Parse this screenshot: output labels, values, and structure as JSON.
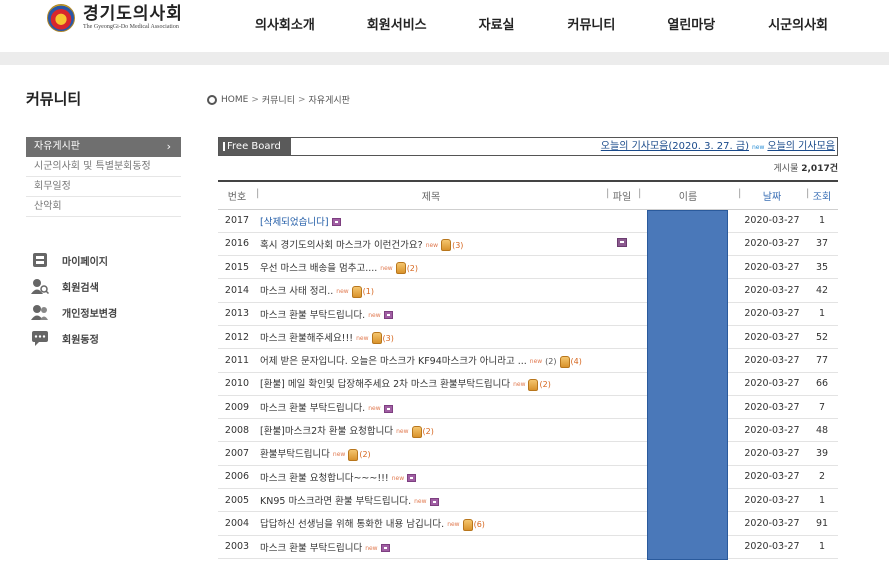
{
  "header": {
    "logo_kr": "경기도의사회",
    "logo_en": "The GyeongGi-Do Medical Association",
    "nav": [
      "의사회소개",
      "회원서비스",
      "자료실",
      "커뮤니티",
      "열린마당",
      "시군의사회"
    ]
  },
  "sidebar": {
    "title": "커뮤니티",
    "items": [
      {
        "label": "자유게시판",
        "active": true,
        "chevron": "›"
      },
      {
        "label": "시군의사회 및 특별분회동정",
        "active": false
      },
      {
        "label": "회무일정",
        "active": false
      },
      {
        "label": "산악회",
        "active": false
      }
    ],
    "quick_links": [
      {
        "label": "마이페이지",
        "icon": "mypage-icon"
      },
      {
        "label": "회원검색",
        "icon": "member-search-icon"
      },
      {
        "label": "개인정보변경",
        "icon": "profile-edit-icon"
      },
      {
        "label": "회원동정",
        "icon": "member-news-icon"
      }
    ]
  },
  "breadcrumb": {
    "home": "HOME",
    "sep": ">",
    "level1": "커뮤니티",
    "level2": "자유게시판"
  },
  "board": {
    "bar_label": "Free Board",
    "ticker_1": "오늘의 기사모음(2020. 3. 27. 금)",
    "ticker_new": "new",
    "ticker_2": "오늘의 기사모음",
    "count_label": "게시물",
    "count_value": "2,017건",
    "headers": {
      "no": "번호",
      "title": "제목",
      "file": "파일",
      "name": "이름",
      "date": "날짜",
      "views": "조회"
    },
    "new_label": "new",
    "rows": [
      {
        "no": "2017",
        "title": "[삭제되었습니다]",
        "deleted": true,
        "new": false,
        "img": true,
        "likes": "",
        "comments": "",
        "file": false,
        "date": "2020-03-27",
        "views": "1"
      },
      {
        "no": "2016",
        "title": "혹시 경기도의사회 마스크가 이런건가요?",
        "deleted": false,
        "new": true,
        "img": false,
        "likes": "(3)",
        "comments": "",
        "file": true,
        "date": "2020-03-27",
        "views": "37"
      },
      {
        "no": "2015",
        "title": "우선 마스크 배송을 멈추고....",
        "deleted": false,
        "new": true,
        "img": false,
        "likes": "(2)",
        "comments": "",
        "file": false,
        "date": "2020-03-27",
        "views": "35"
      },
      {
        "no": "2014",
        "title": "마스크 사태 정리..",
        "deleted": false,
        "new": true,
        "img": false,
        "likes": "(1)",
        "comments": "",
        "file": false,
        "date": "2020-03-27",
        "views": "42"
      },
      {
        "no": "2013",
        "title": "마스크 환불 부탁드립니다.",
        "deleted": false,
        "new": true,
        "img": true,
        "likes": "",
        "comments": "",
        "file": false,
        "date": "2020-03-27",
        "views": "1"
      },
      {
        "no": "2012",
        "title": "마스크 환불해주세요!!!",
        "deleted": false,
        "new": true,
        "img": false,
        "likes": "(3)",
        "comments": "",
        "file": false,
        "date": "2020-03-27",
        "views": "52"
      },
      {
        "no": "2011",
        "title": "어제 받은 문자입니다. 오늘은 마스크가 KF94마스크가 아니라고 ...",
        "deleted": false,
        "new": true,
        "img": false,
        "likes": "(4)",
        "comments": "(2)",
        "file": false,
        "date": "2020-03-27",
        "views": "77"
      },
      {
        "no": "2010",
        "title": "[환불] 메일 확인및 답장해주세요 2차 마스크 환불부탁드립니다",
        "deleted": false,
        "new": true,
        "img": false,
        "likes": "(2)",
        "comments": "",
        "file": false,
        "date": "2020-03-27",
        "views": "66"
      },
      {
        "no": "2009",
        "title": "마스크 환불 부탁드립니다.",
        "deleted": false,
        "new": true,
        "img": true,
        "likes": "",
        "comments": "",
        "file": false,
        "date": "2020-03-27",
        "views": "7"
      },
      {
        "no": "2008",
        "title": "[환불]마스크2차 환불 요청합니다",
        "deleted": false,
        "new": true,
        "img": false,
        "likes": "(2)",
        "comments": "",
        "file": false,
        "date": "2020-03-27",
        "views": "48"
      },
      {
        "no": "2007",
        "title": "환불부탁드립니다",
        "deleted": false,
        "new": true,
        "img": false,
        "likes": "(2)",
        "comments": "",
        "file": false,
        "date": "2020-03-27",
        "views": "39"
      },
      {
        "no": "2006",
        "title": "마스크 환불 요청합니다~~~!!!",
        "deleted": false,
        "new": true,
        "img": true,
        "likes": "",
        "comments": "",
        "file": false,
        "date": "2020-03-27",
        "views": "2"
      },
      {
        "no": "2005",
        "title": "KN95 마스크라면 환불 부탁드립니다.",
        "deleted": false,
        "new": true,
        "img": true,
        "likes": "",
        "comments": "",
        "file": false,
        "date": "2020-03-27",
        "views": "1"
      },
      {
        "no": "2004",
        "title": "답답하신 선생님을 위해 통화한 내용 남깁니다.",
        "deleted": false,
        "new": true,
        "img": false,
        "likes": "(6)",
        "comments": "",
        "file": false,
        "date": "2020-03-27",
        "views": "91"
      },
      {
        "no": "2003",
        "title": "마스크 환불 부탁드립니다",
        "deleted": false,
        "new": true,
        "img": true,
        "likes": "",
        "comments": "",
        "file": false,
        "date": "2020-03-27",
        "views": "1"
      }
    ]
  }
}
